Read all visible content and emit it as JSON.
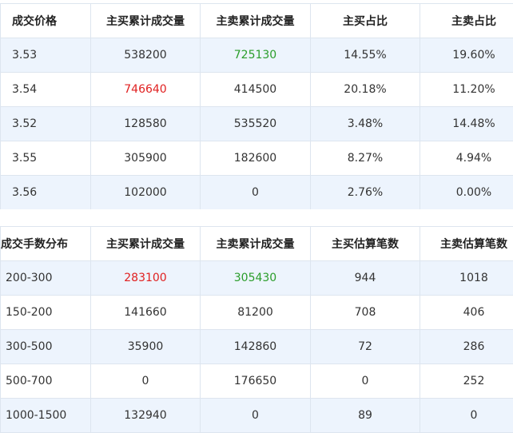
{
  "price_table": {
    "headers": [
      "成交价格",
      "主买累计成交量",
      "主卖累计成交量",
      "主买占比",
      "主卖占比"
    ],
    "rows": [
      [
        "3.53",
        "538200",
        "725130",
        "14.55%",
        "19.60%"
      ],
      [
        "3.54",
        "746640",
        "414500",
        "20.18%",
        "11.20%"
      ],
      [
        "3.52",
        "128580",
        "535520",
        "3.48%",
        "14.48%"
      ],
      [
        "3.55",
        "305900",
        "182600",
        "8.27%",
        "4.94%"
      ],
      [
        "3.56",
        "102000",
        "0",
        "2.76%",
        "0.00%"
      ]
    ]
  },
  "lot_table": {
    "headers": [
      "成交手数分布",
      "主买累计成交量",
      "主卖累计成交量",
      "主买估算笔数",
      "主卖估算笔数"
    ],
    "rows": [
      [
        "200-300",
        "283100",
        "305430",
        "944",
        "1018"
      ],
      [
        "150-200",
        "141660",
        "81200",
        "708",
        "406"
      ],
      [
        "300-500",
        "35900",
        "142860",
        "72",
        "286"
      ],
      [
        "500-700",
        "0",
        "176650",
        "0",
        "252"
      ],
      [
        "1000-1500",
        "132940",
        "0",
        "89",
        "0"
      ]
    ]
  },
  "colors": {
    "highlight_red": "#e02020",
    "highlight_green": "#2a9d2a",
    "row_stripe": "#edf4fd",
    "border": "#dde5ef"
  }
}
